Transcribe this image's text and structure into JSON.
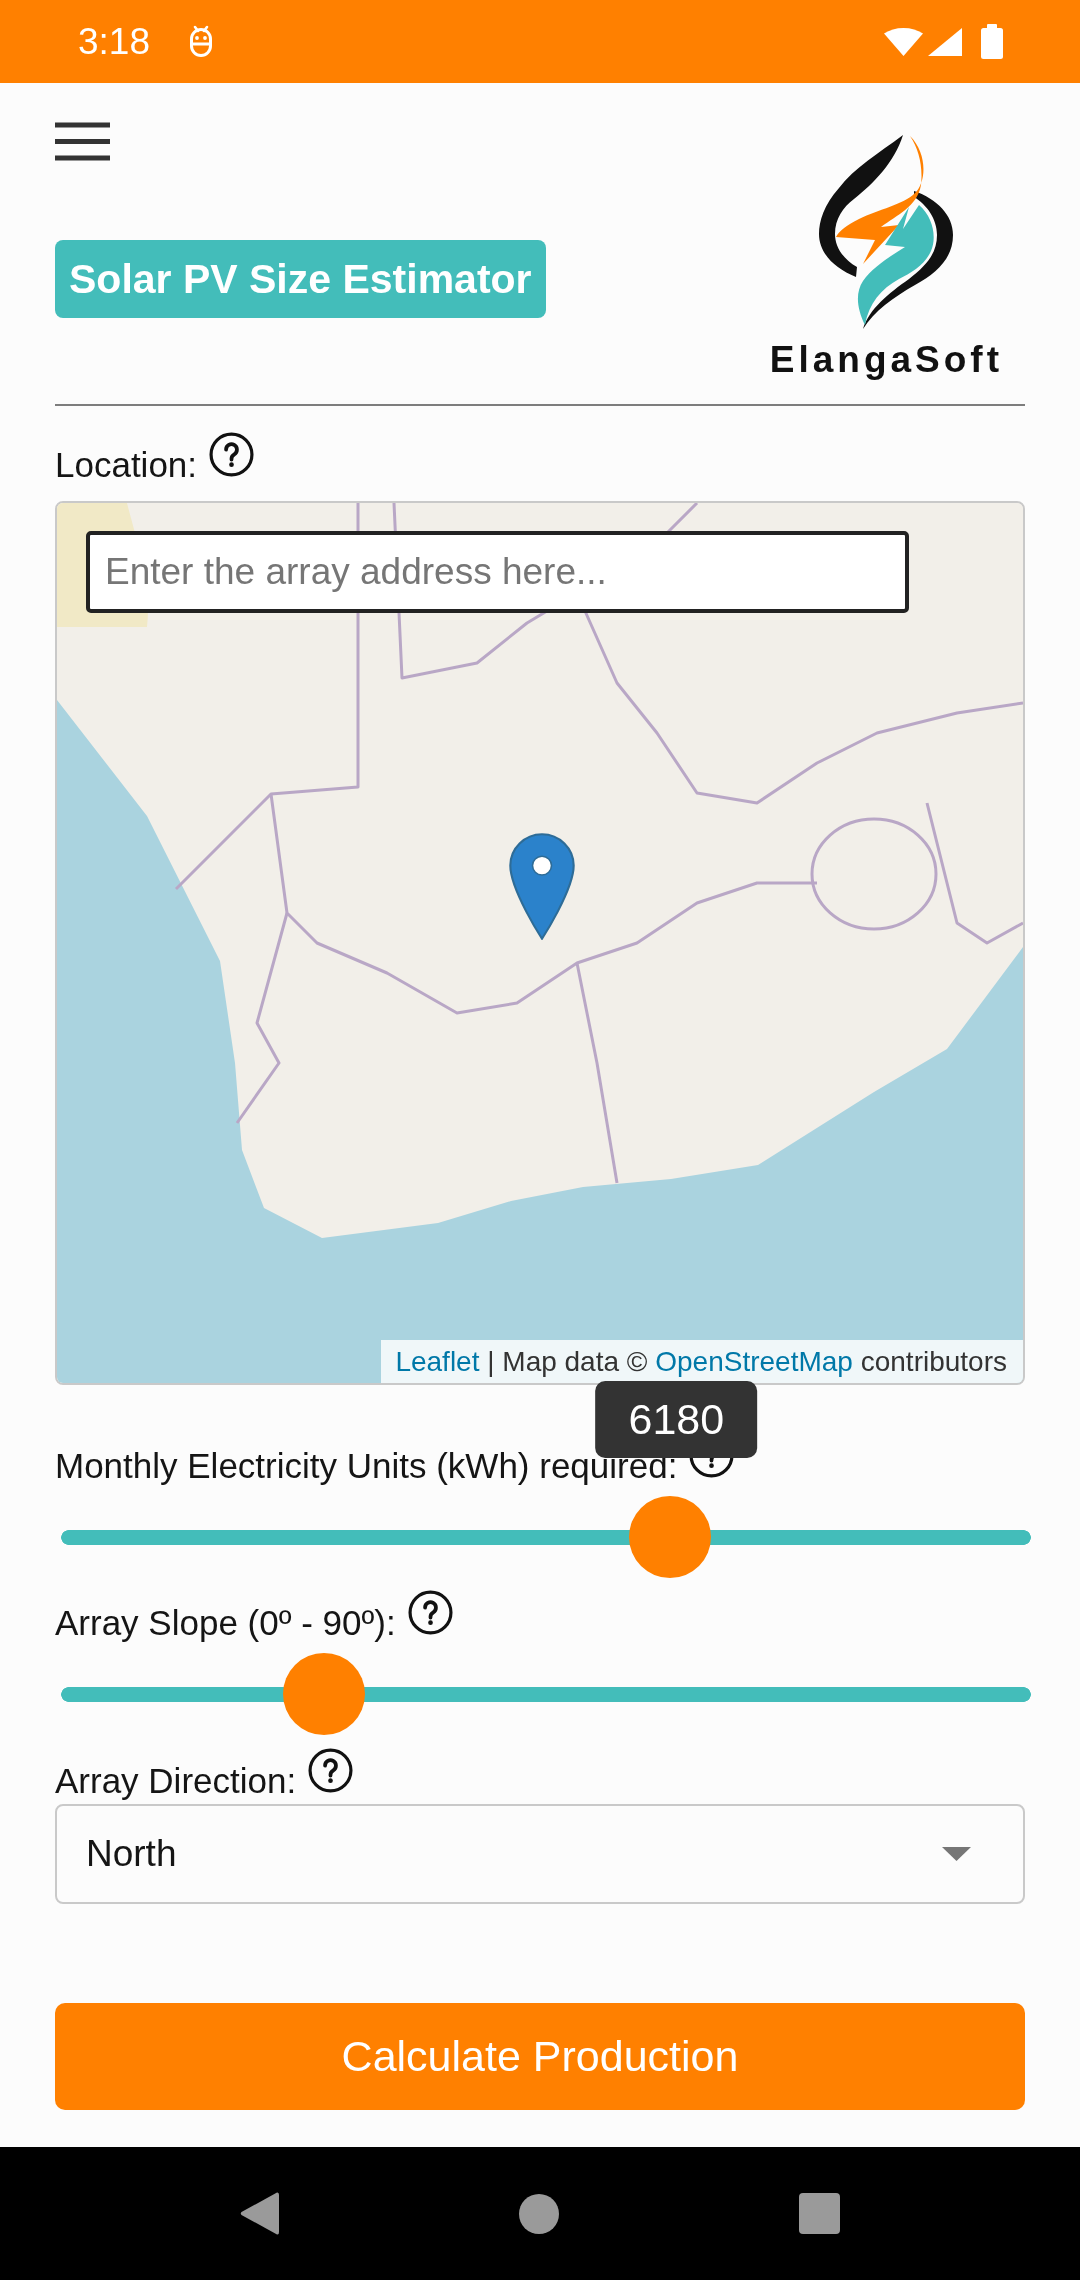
{
  "status_bar": {
    "time": "3:18"
  },
  "header": {
    "title": "Solar PV Size Estimator",
    "logo_text": "ElangaSoft"
  },
  "location": {
    "label": "Location:",
    "search": {
      "placeholder": "Enter the array address here..."
    },
    "attribution": [
      {
        "kind": "link",
        "text": "Leaflet"
      },
      {
        "kind": "text",
        "text": "| Map data ©"
      },
      {
        "kind": "link",
        "text": "OpenStreetMap"
      },
      {
        "kind": "text",
        "text": "contributors"
      }
    ]
  },
  "sliders": [
    {
      "label": "Monthly Electricity Units (kWh) required:",
      "level": 0.64,
      "tooltip": "6180"
    },
    {
      "label": "Array Slope (0º - 90º):",
      "level": 0.25
    }
  ],
  "direction": {
    "label": "Array Direction:",
    "value": "North"
  },
  "buttons": [
    "Calculate Production"
  ]
}
